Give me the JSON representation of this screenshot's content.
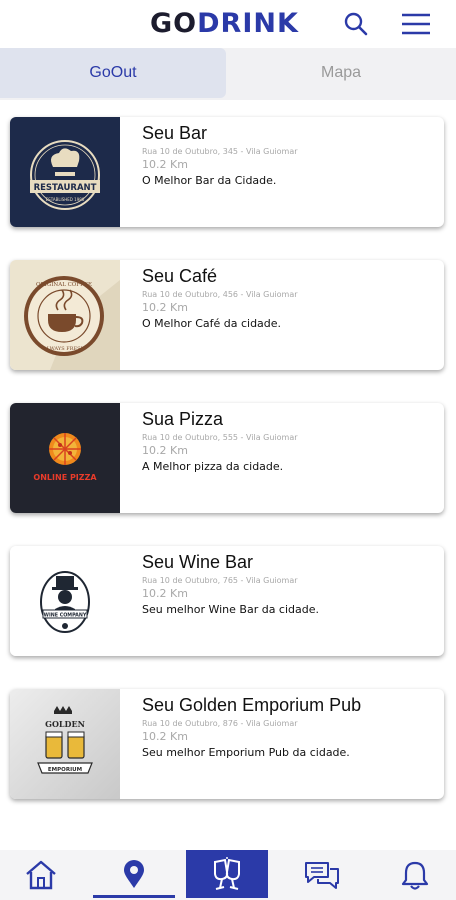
{
  "app": {
    "logo_go": "GO",
    "logo_drink": "DRINK"
  },
  "header": {
    "search_icon": "search-icon",
    "menu_icon": "hamburger-menu-icon"
  },
  "tabs": [
    {
      "label": "GoOut",
      "active": true
    },
    {
      "label": "Mapa",
      "active": false
    }
  ],
  "places": [
    {
      "name": "Seu Bar",
      "address": "Rua 10 de Outubro, 345 - Vila Guiomar",
      "distance": "10.2 Km",
      "description": "O Melhor Bar da Cidade.",
      "logo_text": "RESTAURANT",
      "logo_sub": "ESTABLISHED 1986"
    },
    {
      "name": "Seu Café",
      "address": "Rua 10 de Outubro, 456 - Vila Guiomar",
      "distance": "10.2 Km",
      "description": "O Melhor Café da cidade.",
      "logo_text": "ORIGINAL COFFEE",
      "logo_sub": "ALWAYS FRESH"
    },
    {
      "name": "Sua Pizza",
      "address": "Rua 10 de Outubro, 555 - Vila Guiomar",
      "distance": "10.2 Km",
      "description": "A Melhor pizza da cidade.",
      "logo_text": "ONLINE PIZZA",
      "logo_sub": ""
    },
    {
      "name": "Seu Wine Bar",
      "address": "Rua 10 de Outubro, 765 - Vila Guiomar",
      "distance": "10.2 Km",
      "description": "Seu melhor Wine Bar da cidade.",
      "logo_text": "WINE COMPANY",
      "logo_sub": ""
    },
    {
      "name": "Seu Golden Emporium Pub",
      "address": "Rua 10 de Outubro, 876 - Vila Guiomar",
      "distance": "10.2 Km",
      "description": "Seu melhor Emporium Pub da cidade.",
      "logo_text": "GOLDEN",
      "logo_sub": "EMPORIUM"
    }
  ],
  "bottom_nav": [
    {
      "icon": "home-icon",
      "active": false
    },
    {
      "icon": "map-pin-icon",
      "active": false
    },
    {
      "icon": "cheers-icon",
      "active": true
    },
    {
      "icon": "chat-icon",
      "active": false
    },
    {
      "icon": "bell-icon",
      "active": false
    }
  ],
  "colors": {
    "brand": "#2b3aa8",
    "logo_dark": "#1c1c2e",
    "tab_active_bg": "#dfe3ee",
    "muted_text": "#a8a8a8"
  }
}
